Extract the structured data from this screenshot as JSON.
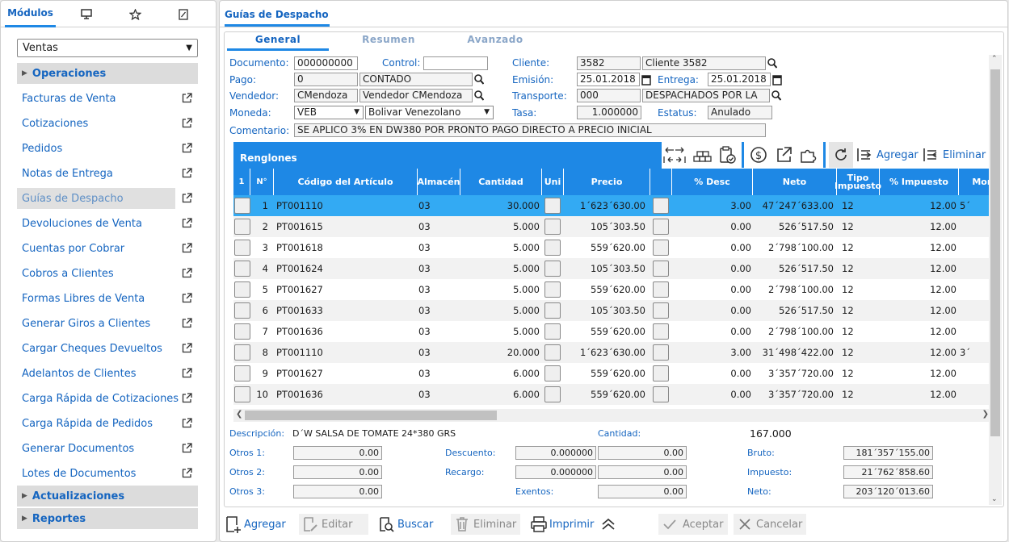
{
  "left": {
    "tabs": [
      "Módulos",
      "monitor-icon",
      "star-icon",
      "wrench-icon"
    ],
    "module_select": "Ventas",
    "section_open": "Operaciones",
    "items": [
      "Facturas de Venta",
      "Cotizaciones",
      "Pedidos",
      "Notas de Entrega",
      "Guías de Despacho",
      "Devoluciones de Venta",
      "Cuentas por Cobrar",
      "Cobros a Clientes",
      "Formas Libres de Venta",
      "Generar Giros a Clientes",
      "Cargar Cheques Devueltos",
      "Adelantos de Clientes",
      "Carga Rápida de Cotizaciones",
      "Carga Rápida de Pedidos",
      "Generar Documentos",
      "Lotes de Documentos"
    ],
    "selected_item": "Guías de Despacho",
    "sections_closed": [
      "Actualizaciones",
      "Reportes"
    ]
  },
  "main": {
    "tab": "Guías de Despacho",
    "subtabs": [
      "General",
      "Resumen",
      "Avanzado"
    ],
    "form": {
      "documento_label": "Documento:",
      "documento": "000000000",
      "control_label": "Control:",
      "control": "",
      "cliente_label": "Cliente:",
      "cliente_code": "3582",
      "cliente_name": "Cliente 3582",
      "pago_label": "Pago:",
      "pago_code": "0",
      "pago_name": "CONTADO",
      "emision_label": "Emisión:",
      "emision": "25.01.2018",
      "entrega_label": "Entrega:",
      "entrega": "25.01.2018",
      "vendedor_label": "Vendedor:",
      "vendedor_code": "CMendoza",
      "vendedor_name": "Vendedor CMendoza",
      "transporte_label": "Transporte:",
      "transporte_code": "000",
      "transporte_name": "DESPACHADOS POR LA",
      "moneda_label": "Moneda:",
      "moneda_code": "VEB",
      "moneda_name": "Bolivar Venezolano",
      "tasa_label": "Tasa:",
      "tasa": "1.000000",
      "estatus_label": "Estatus:",
      "estatus": "Anulado",
      "comentario_label": "Comentario:",
      "comentario": "SE APLICO 3% EN DW380 POR PRONTO PAGO DIRECTO A PRECIO INICIAL"
    },
    "renglones": {
      "title": "Renglones",
      "agregar": "Agregar",
      "eliminar": "Eliminar",
      "headers": [
        "1",
        "N°",
        "Código del Artículo",
        "Almacén",
        "Cantidad",
        "Uni",
        "Precio",
        "",
        "% Desc",
        "Neto",
        "Tipo Impuesto",
        "% Impuesto",
        "Mon"
      ],
      "rows": [
        {
          "n": "1",
          "code": "PT001110",
          "alm": "03",
          "cant": "30.000",
          "precio": "1´623´630.00",
          "desc": "3.00",
          "neto": "47´247´633.00",
          "tipo": "12",
          "imp": "12.00",
          "mon": "5´"
        },
        {
          "n": "2",
          "code": "PT001615",
          "alm": "03",
          "cant": "5.000",
          "precio": "105´303.50",
          "desc": "0.00",
          "neto": "526´517.50",
          "tipo": "12",
          "imp": "12.00",
          "mon": ""
        },
        {
          "n": "3",
          "code": "PT001618",
          "alm": "03",
          "cant": "5.000",
          "precio": "559´620.00",
          "desc": "0.00",
          "neto": "2´798´100.00",
          "tipo": "12",
          "imp": "12.00",
          "mon": ""
        },
        {
          "n": "4",
          "code": "PT001624",
          "alm": "03",
          "cant": "5.000",
          "precio": "105´303.50",
          "desc": "0.00",
          "neto": "526´517.50",
          "tipo": "12",
          "imp": "12.00",
          "mon": ""
        },
        {
          "n": "5",
          "code": "PT001627",
          "alm": "03",
          "cant": "5.000",
          "precio": "559´620.00",
          "desc": "0.00",
          "neto": "2´798´100.00",
          "tipo": "12",
          "imp": "12.00",
          "mon": ""
        },
        {
          "n": "6",
          "code": "PT001633",
          "alm": "03",
          "cant": "5.000",
          "precio": "105´303.50",
          "desc": "0.00",
          "neto": "526´517.50",
          "tipo": "12",
          "imp": "12.00",
          "mon": ""
        },
        {
          "n": "7",
          "code": "PT001636",
          "alm": "03",
          "cant": "5.000",
          "precio": "559´620.00",
          "desc": "0.00",
          "neto": "2´798´100.00",
          "tipo": "12",
          "imp": "12.00",
          "mon": ""
        },
        {
          "n": "8",
          "code": "PT001110",
          "alm": "03",
          "cant": "20.000",
          "precio": "1´623´630.00",
          "desc": "3.00",
          "neto": "31´498´422.00",
          "tipo": "12",
          "imp": "12.00",
          "mon": "3´"
        },
        {
          "n": "9",
          "code": "PT001627",
          "alm": "03",
          "cant": "6.000",
          "precio": "559´620.00",
          "desc": "0.00",
          "neto": "3´357´720.00",
          "tipo": "12",
          "imp": "12.00",
          "mon": ""
        },
        {
          "n": "10",
          "code": "PT001636",
          "alm": "03",
          "cant": "6.000",
          "precio": "559´620.00",
          "desc": "0.00",
          "neto": "3´357´720.00",
          "tipo": "12",
          "imp": "12.00",
          "mon": ""
        }
      ]
    },
    "summary": {
      "descripcion_label": "Descripción:",
      "descripcion": "D´W SALSA DE TOMATE 24*380 GRS",
      "cantidad_label": "Cantidad:",
      "cantidad": "167.000",
      "otros1_label": "Otros 1:",
      "otros1": "0.00",
      "otros2_label": "Otros 2:",
      "otros2": "0.00",
      "otros3_label": "Otros 3:",
      "otros3": "0.00",
      "descuento_label": "Descuento:",
      "descuento_pct": "0.000000",
      "descuento": "0.00",
      "recargo_label": "Recargo:",
      "recargo_pct": "0.000000",
      "recargo": "0.00",
      "exentos_label": "Exentos:",
      "exentos": "0.00",
      "bruto_label": "Bruto:",
      "bruto": "181´357´155.00",
      "impuesto_label": "Impuesto:",
      "impuesto": "21´762´858.60",
      "neto_label": "Neto:",
      "neto": "203´120´013.60"
    },
    "buttons": {
      "agregar": "Agregar",
      "editar": "Editar",
      "buscar": "Buscar",
      "eliminar": "Eliminar",
      "imprimir": "Imprimir",
      "aceptar": "Aceptar",
      "cancelar": "Cancelar"
    }
  }
}
